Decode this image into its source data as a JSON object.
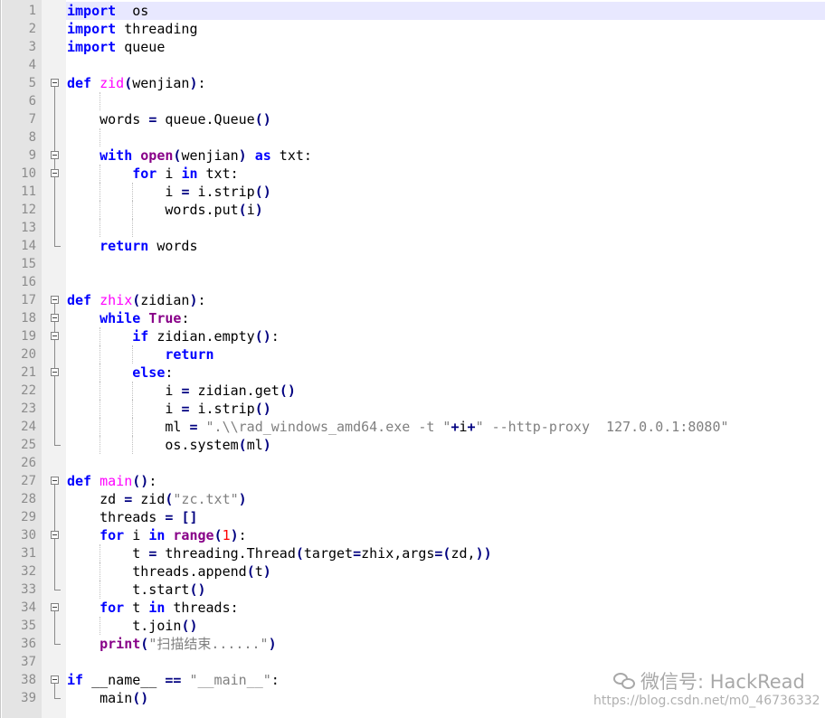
{
  "editor": {
    "current_line": 1,
    "watermark_label": "微信号: HackRead",
    "watermark_url": "https://blog.csdn.net/m0_46736332"
  },
  "lines": [
    {
      "n": "1",
      "tokens": [
        [
          "kw",
          "import"
        ],
        [
          "",
          "  os"
        ]
      ]
    },
    {
      "n": "2",
      "tokens": [
        [
          "kw",
          "import"
        ],
        [
          "",
          " threading"
        ]
      ]
    },
    {
      "n": "3",
      "tokens": [
        [
          "kw",
          "import"
        ],
        [
          "",
          " queue"
        ]
      ]
    },
    {
      "n": "4",
      "tokens": []
    },
    {
      "n": "5",
      "tokens": [
        [
          "kw",
          "def"
        ],
        [
          "",
          " "
        ],
        [
          "fn",
          "zid"
        ],
        [
          "op",
          "("
        ],
        [
          "",
          "wenjian"
        ],
        [
          "op",
          ")"
        ],
        [
          "",
          ":"
        ]
      ]
    },
    {
      "n": "6",
      "tokens": []
    },
    {
      "n": "7",
      "tokens": [
        [
          "",
          "    words "
        ],
        [
          "op",
          "="
        ],
        [
          "",
          " queue.Queue"
        ],
        [
          "op",
          "()"
        ]
      ]
    },
    {
      "n": "8",
      "tokens": []
    },
    {
      "n": "9",
      "tokens": [
        [
          "",
          "    "
        ],
        [
          "kw",
          "with"
        ],
        [
          "",
          " "
        ],
        [
          "kw2",
          "open"
        ],
        [
          "op",
          "("
        ],
        [
          "",
          "wenjian"
        ],
        [
          "op",
          ")"
        ],
        [
          "",
          " "
        ],
        [
          "kw",
          "as"
        ],
        [
          "",
          " txt:"
        ]
      ]
    },
    {
      "n": "10",
      "tokens": [
        [
          "",
          "        "
        ],
        [
          "kw",
          "for"
        ],
        [
          "",
          " i "
        ],
        [
          "kw",
          "in"
        ],
        [
          "",
          " txt:"
        ]
      ]
    },
    {
      "n": "11",
      "tokens": [
        [
          "",
          "            i "
        ],
        [
          "op",
          "="
        ],
        [
          "",
          " i.strip"
        ],
        [
          "op",
          "()"
        ]
      ]
    },
    {
      "n": "12",
      "tokens": [
        [
          "",
          "            words.put"
        ],
        [
          "op",
          "("
        ],
        [
          "",
          "i"
        ],
        [
          "op",
          ")"
        ]
      ]
    },
    {
      "n": "13",
      "tokens": []
    },
    {
      "n": "14",
      "tokens": [
        [
          "",
          "    "
        ],
        [
          "kw",
          "return"
        ],
        [
          "",
          " words"
        ]
      ]
    },
    {
      "n": "15",
      "tokens": []
    },
    {
      "n": "16",
      "tokens": []
    },
    {
      "n": "17",
      "tokens": [
        [
          "kw",
          "def"
        ],
        [
          "",
          " "
        ],
        [
          "fn",
          "zhix"
        ],
        [
          "op",
          "("
        ],
        [
          "",
          "zidian"
        ],
        [
          "op",
          ")"
        ],
        [
          "",
          ":"
        ]
      ]
    },
    {
      "n": "18",
      "tokens": [
        [
          "",
          "    "
        ],
        [
          "kw",
          "while"
        ],
        [
          "",
          " "
        ],
        [
          "kw2",
          "True"
        ],
        [
          "",
          ":"
        ]
      ]
    },
    {
      "n": "19",
      "tokens": [
        [
          "",
          "        "
        ],
        [
          "kw",
          "if"
        ],
        [
          "",
          " zidian.empty"
        ],
        [
          "op",
          "()"
        ],
        [
          "",
          ":"
        ]
      ]
    },
    {
      "n": "20",
      "tokens": [
        [
          "",
          "            "
        ],
        [
          "kw",
          "return"
        ]
      ]
    },
    {
      "n": "21",
      "tokens": [
        [
          "",
          "        "
        ],
        [
          "kw",
          "else"
        ],
        [
          "",
          ":"
        ]
      ]
    },
    {
      "n": "22",
      "tokens": [
        [
          "",
          "            i "
        ],
        [
          "op",
          "="
        ],
        [
          "",
          " zidian.get"
        ],
        [
          "op",
          "()"
        ]
      ]
    },
    {
      "n": "23",
      "tokens": [
        [
          "",
          "            i "
        ],
        [
          "op",
          "="
        ],
        [
          "",
          " i.strip"
        ],
        [
          "op",
          "()"
        ]
      ]
    },
    {
      "n": "24",
      "tokens": [
        [
          "",
          "            ml "
        ],
        [
          "op",
          "="
        ],
        [
          "",
          " "
        ],
        [
          "str",
          "\".\\\\rad_windows_amd64.exe -t \""
        ],
        [
          "op",
          "+"
        ],
        [
          "",
          "i"
        ],
        [
          "op",
          "+"
        ],
        [
          "str",
          "\" --http-proxy  127.0.0.1:8080\""
        ]
      ]
    },
    {
      "n": "25",
      "tokens": [
        [
          "",
          "            os.system"
        ],
        [
          "op",
          "("
        ],
        [
          "",
          "ml"
        ],
        [
          "op",
          ")"
        ]
      ]
    },
    {
      "n": "26",
      "tokens": []
    },
    {
      "n": "27",
      "tokens": [
        [
          "kw",
          "def"
        ],
        [
          "",
          " "
        ],
        [
          "fn",
          "main"
        ],
        [
          "op",
          "()"
        ],
        [
          "",
          ":"
        ]
      ]
    },
    {
      "n": "28",
      "tokens": [
        [
          "",
          "    zd "
        ],
        [
          "op",
          "="
        ],
        [
          "",
          " zid"
        ],
        [
          "op",
          "("
        ],
        [
          "str",
          "\"zc.txt\""
        ],
        [
          "op",
          ")"
        ]
      ]
    },
    {
      "n": "29",
      "tokens": [
        [
          "",
          "    threads "
        ],
        [
          "op",
          "="
        ],
        [
          "",
          " "
        ],
        [
          "op",
          "[]"
        ]
      ]
    },
    {
      "n": "30",
      "tokens": [
        [
          "",
          "    "
        ],
        [
          "kw",
          "for"
        ],
        [
          "",
          " i "
        ],
        [
          "kw",
          "in"
        ],
        [
          "",
          " "
        ],
        [
          "kw2",
          "range"
        ],
        [
          "op",
          "("
        ],
        [
          "num",
          "1"
        ],
        [
          "op",
          ")"
        ],
        [
          "",
          ":"
        ]
      ]
    },
    {
      "n": "31",
      "tokens": [
        [
          "",
          "        t "
        ],
        [
          "op",
          "="
        ],
        [
          "",
          " threading.Thread"
        ],
        [
          "op",
          "("
        ],
        [
          "",
          "target"
        ],
        [
          "op",
          "="
        ],
        [
          "",
          "zhix,args"
        ],
        [
          "op",
          "=("
        ],
        [
          "",
          "zd,"
        ],
        [
          "op",
          "))"
        ]
      ]
    },
    {
      "n": "32",
      "tokens": [
        [
          "",
          "        threads.append"
        ],
        [
          "op",
          "("
        ],
        [
          "",
          "t"
        ],
        [
          "op",
          ")"
        ]
      ]
    },
    {
      "n": "33",
      "tokens": [
        [
          "",
          "        t.start"
        ],
        [
          "op",
          "()"
        ]
      ]
    },
    {
      "n": "34",
      "tokens": [
        [
          "",
          "    "
        ],
        [
          "kw",
          "for"
        ],
        [
          "",
          " t "
        ],
        [
          "kw",
          "in"
        ],
        [
          "",
          " threads:"
        ]
      ]
    },
    {
      "n": "35",
      "tokens": [
        [
          "",
          "        t.join"
        ],
        [
          "op",
          "()"
        ]
      ]
    },
    {
      "n": "36",
      "tokens": [
        [
          "",
          "    "
        ],
        [
          "kw2",
          "print"
        ],
        [
          "op",
          "("
        ],
        [
          "str",
          "\"扫描结束......\""
        ],
        [
          "op",
          ")"
        ]
      ]
    },
    {
      "n": "37",
      "tokens": []
    },
    {
      "n": "38",
      "tokens": [
        [
          "kw",
          "if"
        ],
        [
          "",
          " __name__ "
        ],
        [
          "op",
          "=="
        ],
        [
          "",
          " "
        ],
        [
          "str",
          "\"__main__\""
        ],
        [
          "",
          ":"
        ]
      ]
    },
    {
      "n": "39",
      "tokens": [
        [
          "",
          "    main"
        ],
        [
          "op",
          "()"
        ]
      ]
    }
  ]
}
